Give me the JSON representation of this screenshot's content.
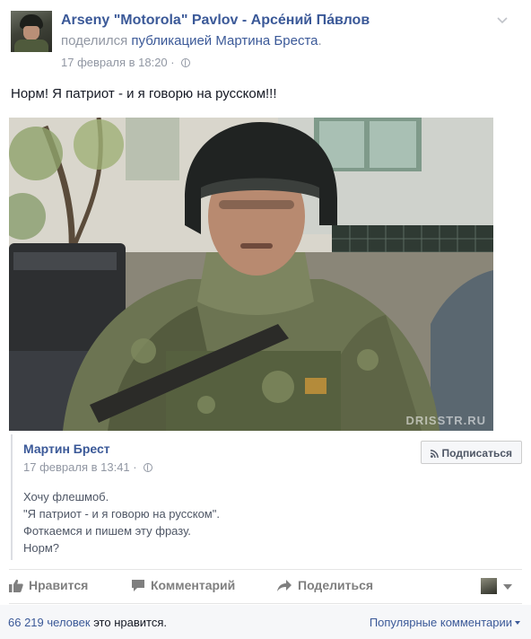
{
  "post": {
    "author": "Arseny \"Motorola\" Pavlov - Арсе́ний Па́влов",
    "shared_prefix": "поделился",
    "shared_link": "публикацией Мартина Бреста",
    "shared_suffix": ".",
    "timestamp": "17 февраля в 18:20",
    "separator": "·",
    "privacy_icon": "globe-icon",
    "menu_icon": "chevron-down-icon",
    "status_text": "Норм! Я патриот - и я говорю на русском!!!"
  },
  "photo": {
    "watermark": "DRISSTR.RU"
  },
  "quoted": {
    "author": "Мартин Брест",
    "timestamp": "17 февраля в 13:41",
    "separator": "·",
    "subscribe_label": "Подписаться",
    "lines": [
      "Хочу флешмоб.",
      "\"Я патриот - и я говорю на русском\".",
      "Фоткаемся и пишем эту фразу.",
      "Норм?"
    ]
  },
  "actions": {
    "like_label": "Нравится",
    "comment_label": "Комментарий",
    "share_label": "Поделиться"
  },
  "likes": {
    "count": "66 219 человек",
    "suffix": " это нравится.",
    "popular_label": "Популярные комментарии"
  },
  "colors": {
    "link": "#3b5998",
    "muted": "#9197a3",
    "action": "#7f7f7f"
  }
}
